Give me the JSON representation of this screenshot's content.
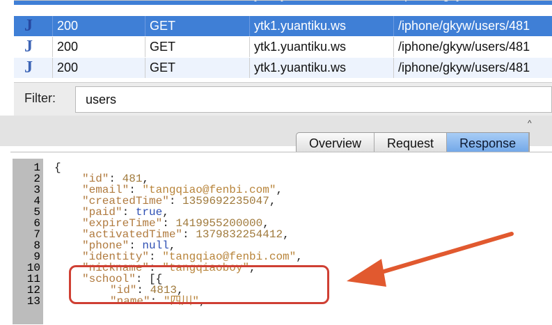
{
  "requests": {
    "rows": [
      {
        "status": "200",
        "method": "GET",
        "host": "ytk1.yuantiku.ws",
        "path": "/iphone/gkyw/users/481"
      },
      {
        "status": "200",
        "method": "GET",
        "host": "ytk1.yuantiku.ws",
        "path": "/iphone/gkyw/users/481"
      },
      {
        "status": "200",
        "method": "GET",
        "host": "ytk1.yuantiku.ws",
        "path": "/iphone/gkyw/users/481"
      }
    ],
    "icon": "J"
  },
  "filter": {
    "label": "Filter:",
    "value": "users"
  },
  "tabs": {
    "overview": "Overview",
    "request": "Request",
    "response": "Response",
    "active": "Response"
  },
  "caret": "^",
  "response": {
    "line_numbers": [
      "1",
      "2",
      "3",
      "4",
      "5",
      "6",
      "7",
      "8",
      "9",
      "10",
      "11",
      "12",
      "13"
    ],
    "lines": {
      "l1_open": "{",
      "id_key": "\"id\"",
      "id_val": "481",
      "email_key": "\"email\"",
      "email_val": "\"tangqiao@fenbi.com\"",
      "created_key": "\"createdTime\"",
      "created_val": "1359692235047",
      "paid_key": "\"paid\"",
      "paid_val": "true",
      "expire_key": "\"expireTime\"",
      "expire_val": "1419955200000",
      "activated_key": "\"activatedTime\"",
      "activated_val": "1379832254412",
      "phone_key": "\"phone\"",
      "phone_val": "null",
      "identity_key": "\"identity\"",
      "identity_val": "\"tangqiao@fenbi.com\"",
      "nickname_key": "\"nickname\"",
      "nickname_val": "\"tangqiaoboy\"",
      "school_key": "\"school\"",
      "school_val": "[{",
      "inner_id_key": "\"id\"",
      "inner_id_val": "4813",
      "name_key": "\"name\"",
      "name_val": "\"四川\""
    }
  },
  "colors": {
    "selected_row": "#3f7fd6",
    "highlight": "#cf3f33",
    "arrow": "#e1592f"
  }
}
